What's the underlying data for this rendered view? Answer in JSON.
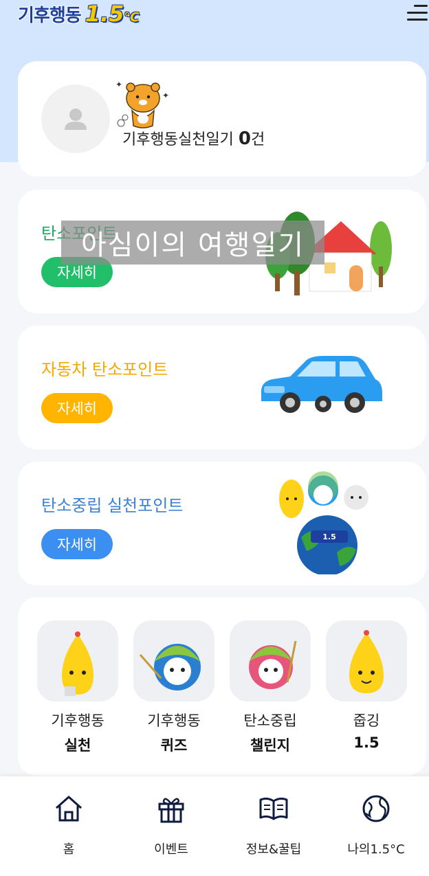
{
  "header": {
    "logo_text": "기후행동",
    "logo_number": "1.5",
    "logo_unit": "℃",
    "menu_icon": "hamburger-menu-icon"
  },
  "profile": {
    "diary_label": "기후행동실천일기",
    "diary_count": "0",
    "diary_unit": "건",
    "avatar_icon": "user-icon",
    "character": "ryan-character"
  },
  "overlay_caption": "아심이의 여행일기",
  "points": [
    {
      "title": "탄소포인트",
      "button": "자세히",
      "color": "#22bf6a",
      "title_color": "#22a45f",
      "illustration": "house-trees-illustration"
    },
    {
      "title": "자동차 탄소포인트",
      "button": "자세히",
      "color": "#ffb400",
      "title_color": "#f2a800",
      "illustration": "blue-car-illustration"
    },
    {
      "title": "탄소중립 실천포인트",
      "button": "자세히",
      "color": "#3a8ff0",
      "title_color": "#3a82d6",
      "illustration": "mascots-earth-illustration"
    }
  ],
  "menu": [
    {
      "line1": "기후행동",
      "line2": "실천",
      "icon": "yellow-mascot-icon"
    },
    {
      "line1": "기후행동",
      "line2": "퀴즈",
      "icon": "blue-mascot-icon"
    },
    {
      "line1": "탄소중립",
      "line2": "챌린지",
      "icon": "pink-mascot-icon"
    },
    {
      "line1": "줍깅",
      "line2": "1.5",
      "icon": "yellow-mascot-icon"
    }
  ],
  "nav": [
    {
      "label": "홈",
      "icon": "home-icon"
    },
    {
      "label": "이벤트",
      "icon": "gift-icon"
    },
    {
      "label": "정보&꿀팁",
      "icon": "book-icon"
    },
    {
      "label": "나의1.5°C",
      "icon": "globe-icon"
    }
  ]
}
